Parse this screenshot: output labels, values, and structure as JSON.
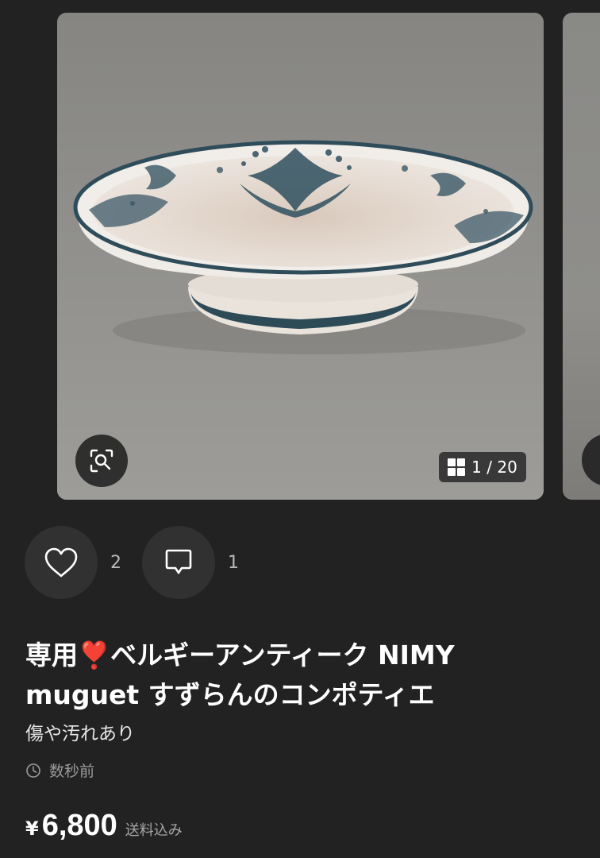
{
  "carousel": {
    "counter": "1 / 20",
    "current_index": 1,
    "total": 20
  },
  "actions": {
    "like_count": "2",
    "comment_count": "1"
  },
  "item": {
    "title": "専用❣️ベルギーアンティーク NIMY muguet すずらんのコンポティエ",
    "condition": "傷や汚れあり",
    "posted": "数秒前",
    "currency_symbol": "¥",
    "price": "6,800",
    "shipping": "送料込み"
  },
  "colors": {
    "background": "#222222",
    "button_bg": "#313131",
    "text_primary": "#ffffff",
    "text_secondary": "#9b9b9b"
  },
  "icons": [
    "zoom-scan-icon",
    "grid-icon",
    "heart-icon",
    "comment-icon",
    "clock-icon"
  ]
}
